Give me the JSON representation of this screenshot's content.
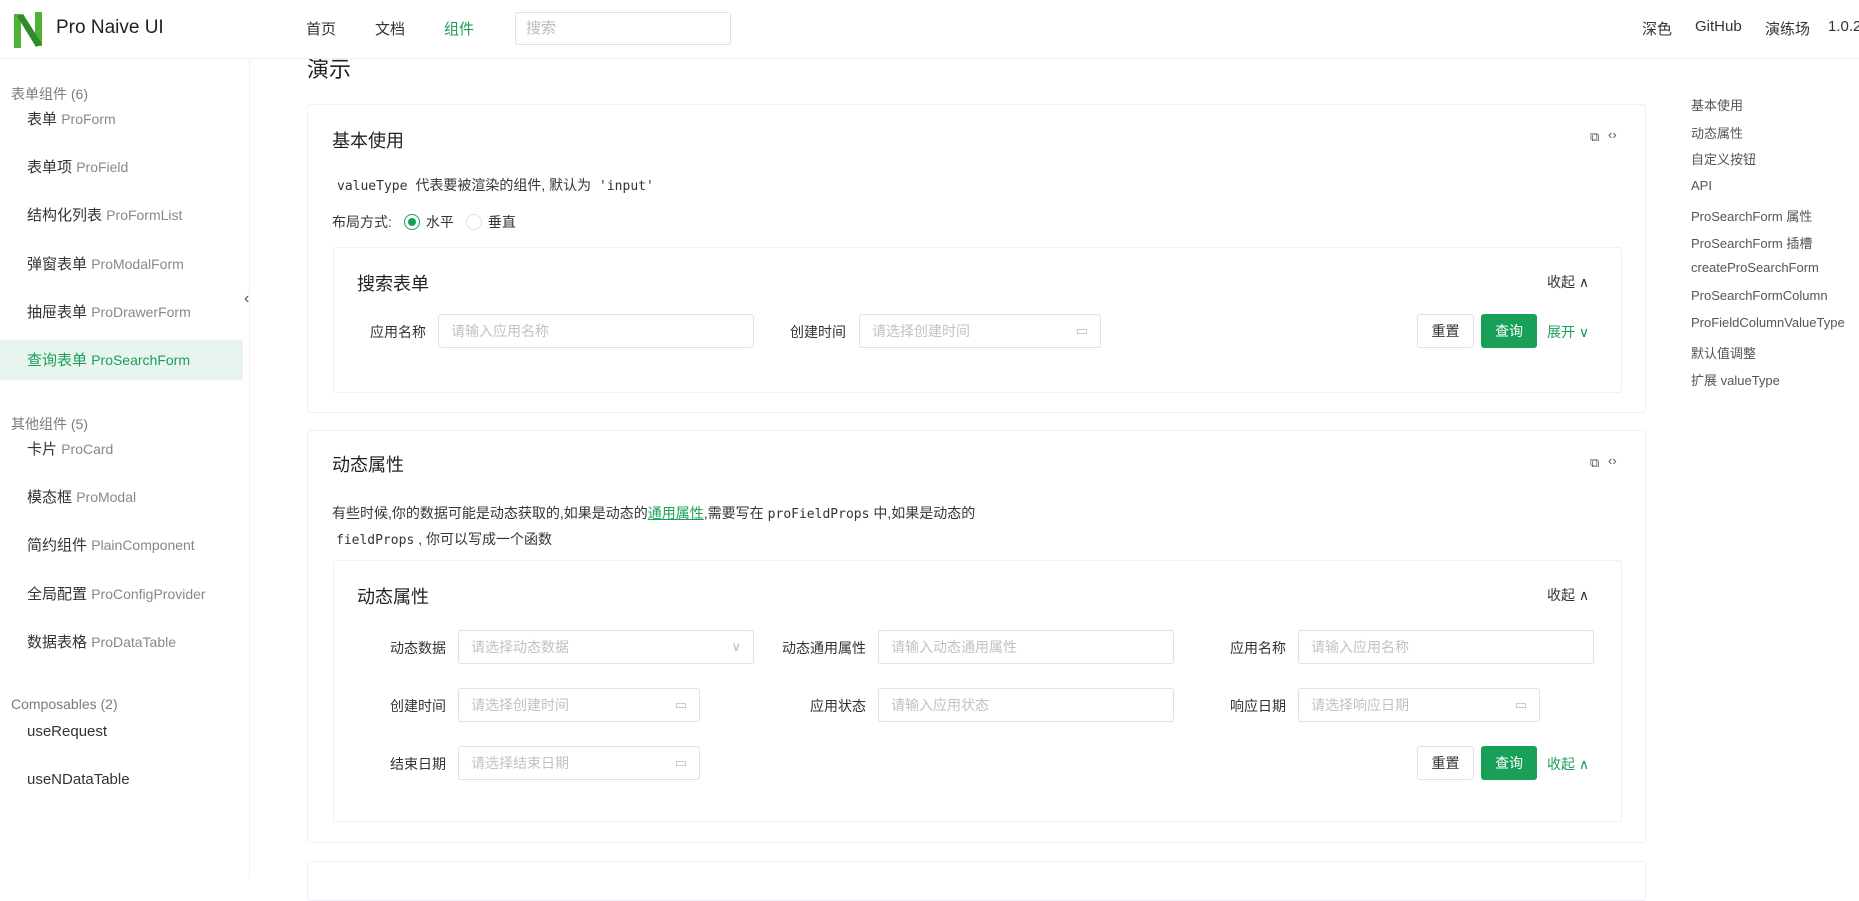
{
  "header": {
    "brand": "Pro Naive UI",
    "nav": [
      "首页",
      "文档",
      "组件"
    ],
    "search_placeholder": "搜索",
    "right": [
      "深色",
      "GitHub",
      "演练场",
      "1.0.2"
    ]
  },
  "sidebar": {
    "groups": [
      {
        "title": "表单组件 (6)",
        "items": [
          [
            "表单",
            "ProForm"
          ],
          [
            "表单项",
            "ProField"
          ],
          [
            "结构化列表",
            "ProFormList"
          ],
          [
            "弹窗表单",
            "ProModalForm"
          ],
          [
            "抽屉表单",
            "ProDrawerForm"
          ],
          [
            "查询表单",
            "ProSearchForm"
          ]
        ]
      },
      {
        "title": "其他组件 (5)",
        "items": [
          [
            "卡片",
            "ProCard"
          ],
          [
            "模态框",
            "ProModal"
          ],
          [
            "简约组件",
            "PlainComponent"
          ],
          [
            "全局配置",
            "ProConfigProvider"
          ],
          [
            "数据表格",
            "ProDataTable"
          ]
        ]
      },
      {
        "title": "Composables (2)",
        "items": [
          [
            "useRequest",
            ""
          ],
          [
            "useNDataTable",
            ""
          ]
        ]
      }
    ]
  },
  "main": {
    "section_title": "演示",
    "card1": {
      "title": "基本使用",
      "desc_code1": "valueType",
      "desc_text": "代表要被渲染的组件, 默认为",
      "desc_code2": "'input'",
      "layout_label": "布局方式:",
      "radio_h": "水平",
      "radio_v": "垂直",
      "form": {
        "title": "搜索表单",
        "collapse": "收起",
        "f1_label": "应用名称",
        "f1_ph": "请输入应用名称",
        "f2_label": "创建时间",
        "f2_ph": "请选择创建时间",
        "reset": "重置",
        "query": "查询",
        "expand": "展开"
      }
    },
    "card2": {
      "title": "动态属性",
      "desc1": "有些时候,你的数据可能是动态获取的,如果是动态的",
      "link": "通用属性",
      "desc2": ",需要写在",
      "code1": "proFieldProps",
      "desc3": "中,如果是动态的",
      "code2": "fieldProps",
      "desc4": ", 你可以写成一个函数",
      "form": {
        "title": "动态属性",
        "collapse": "收起",
        "fields": [
          {
            "label": "动态数据",
            "ph": "请选择动态数据"
          },
          {
            "label": "动态通用属性",
            "ph": "请输入动态通用属性"
          },
          {
            "label": "应用名称",
            "ph": "请输入应用名称"
          },
          {
            "label": "创建时间",
            "ph": "请选择创建时间"
          },
          {
            "label": "应用状态",
            "ph": "请输入应用状态"
          },
          {
            "label": "响应日期",
            "ph": "请选择响应日期"
          },
          {
            "label": "结束日期",
            "ph": "请选择结束日期"
          }
        ],
        "reset": "重置",
        "query": "查询",
        "toggle": "收起"
      }
    }
  },
  "toc": [
    "基本使用",
    "动态属性",
    "自定义按钮",
    "API",
    "ProSearchForm 属性",
    "ProSearchForm 插槽",
    "createProSearchForm",
    "ProSearchFormColumn",
    "ProFieldColumnValueType",
    "默认值调整",
    "扩展 valueType"
  ],
  "colors": {
    "accent": "#18a058"
  }
}
